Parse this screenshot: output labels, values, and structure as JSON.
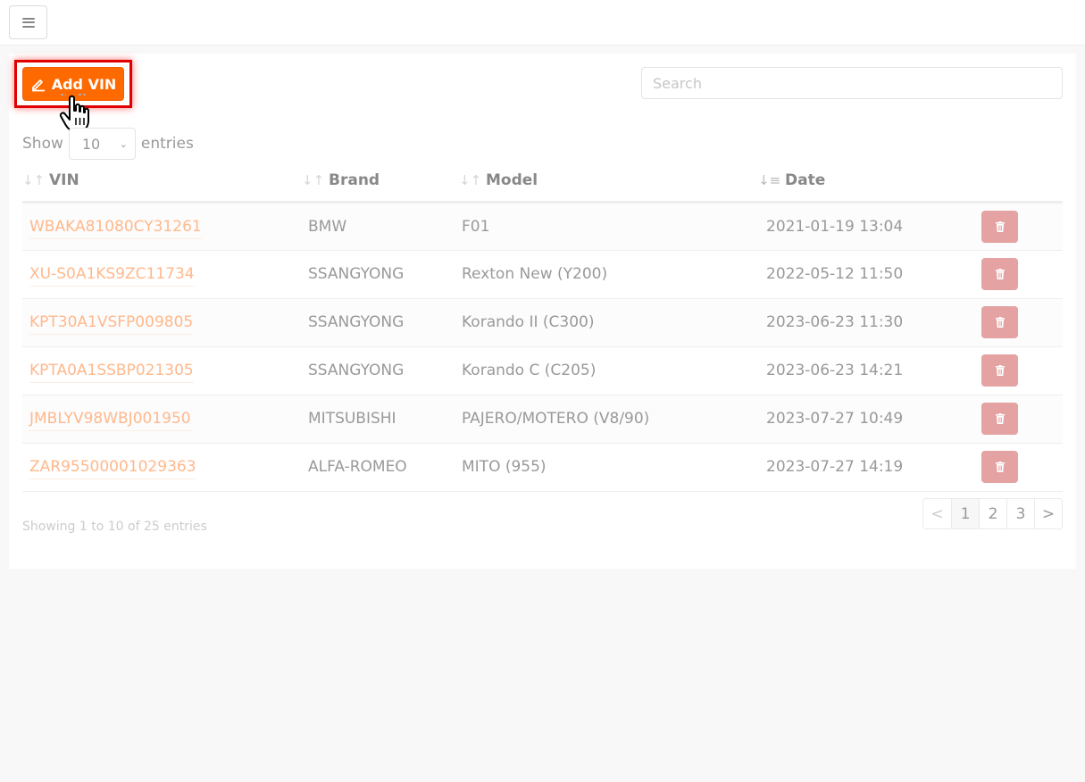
{
  "topbar": {
    "menu_icon": "hamburger-icon"
  },
  "toolbar": {
    "add_label": "Add VIN",
    "add_icon": "pencil-icon",
    "search_placeholder": "Search"
  },
  "length_menu": {
    "prefix": "Show",
    "selected": "10",
    "suffix": "entries"
  },
  "table": {
    "columns": [
      {
        "label": "VIN",
        "sort": "unsorted"
      },
      {
        "label": "Brand",
        "sort": "unsorted"
      },
      {
        "label": "Model",
        "sort": "unsorted"
      },
      {
        "label": "Date",
        "sort": "descending"
      }
    ],
    "rows": [
      {
        "vin": "WBAKA81080CY31261",
        "brand": "BMW",
        "model": "F01",
        "date": "2021-01-19 13:04"
      },
      {
        "vin": "XU-S0A1KS9ZC11734",
        "brand": "SSANGYONG",
        "model": "Rexton New (Y200)",
        "date": "2022-05-12 11:50"
      },
      {
        "vin": "KPT30A1VSFP009805",
        "brand": "SSANGYONG",
        "model": "Korando II (C300)",
        "date": "2023-06-23 11:30"
      },
      {
        "vin": "KPTA0A1SSBP021305",
        "brand": "SSANGYONG",
        "model": "Korando C (C205)",
        "date": "2023-06-23 14:21"
      },
      {
        "vin": "JMBLYV98WBJ001950",
        "brand": "MITSUBISHI",
        "model": "PAJERO/MOTERO (V8/90)",
        "date": "2023-07-27 10:49"
      },
      {
        "vin": "ZAR95500001029363",
        "brand": "ALFA-ROMEO",
        "model": "MITO (955)",
        "date": "2023-07-27 14:19"
      }
    ],
    "delete_icon": "trash-icon"
  },
  "footer": {
    "info": "Showing 1 to 10 of 25 entries",
    "pagination": {
      "prev": "<",
      "pages": [
        "1",
        "2",
        "3"
      ],
      "next": ">",
      "current": "1"
    }
  },
  "colors": {
    "accent": "#ff6a00",
    "link": "#ffb88c",
    "delete": "#e5a2a2",
    "highlight": "#e00000"
  }
}
